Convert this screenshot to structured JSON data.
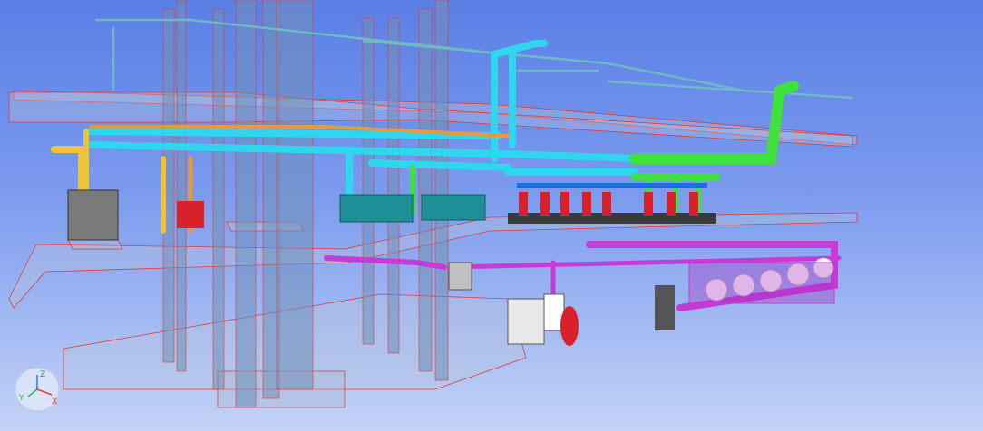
{
  "app": {
    "view": "3D Model View"
  },
  "colors": {
    "sky_top": "#5a7fe6",
    "sky_bottom": "#c4d3f6",
    "slab_fill": "#b9c6dd",
    "slab_edge": "#e23a3a",
    "column_fill": "#6f8fb8",
    "pipe_cyan": "#2fd7ee",
    "pipe_yellow": "#f0c23a",
    "pipe_green": "#3ee23a",
    "pipe_magenta": "#c63ad6",
    "pipe_orange": "#e89a3a",
    "pump_red": "#d8212a",
    "chiller_teal": "#1f8f96",
    "boiler_white": "#ffffff"
  },
  "axis_widget": {
    "z": "Z",
    "y": "Y",
    "x": "X"
  }
}
